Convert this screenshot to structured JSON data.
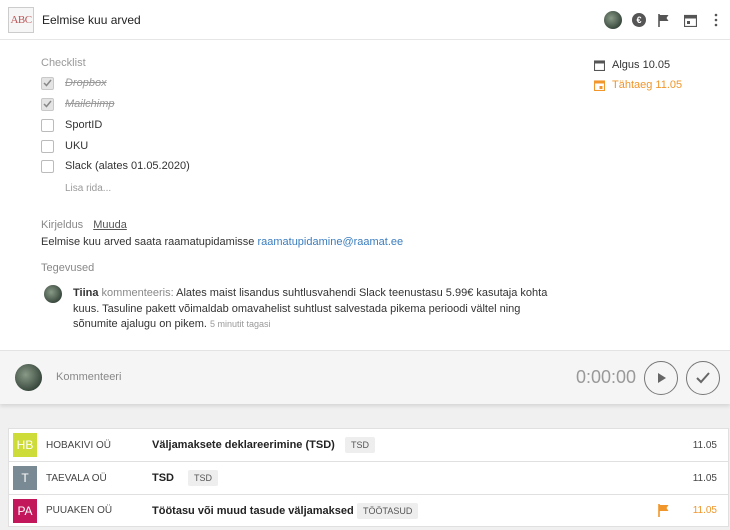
{
  "header": {
    "logo_text": "ABC",
    "title": "Eelmise kuu arved",
    "icons": [
      "avatar",
      "euro-icon",
      "flag-icon",
      "calendar-icon",
      "more-vertical-icon"
    ],
    "euro_symbol": "€"
  },
  "checklist": {
    "label": "Checklist",
    "items": [
      {
        "text": "Dropbox",
        "done": true
      },
      {
        "text": "Mailchimp",
        "done": true
      },
      {
        "text": "SportID",
        "done": false
      },
      {
        "text": "UKU",
        "done": false
      },
      {
        "text": "Slack (alates 01.05.2020)",
        "done": false
      }
    ],
    "add_placeholder": "Lisa rida..."
  },
  "dates": {
    "start": "Algus 10.05",
    "due": "Tähtaeg 11.05",
    "due_color": "#f0962a"
  },
  "description": {
    "label": "Kirjeldus",
    "edit_link": "Muuda",
    "text": "Eelmise kuu arved saata raamatupidamisse",
    "email": "raamatupidamine@raamat.ee"
  },
  "activities": {
    "label": "Tegevused",
    "items": [
      {
        "author": "Tiina",
        "verb": "kommenteeris:",
        "text": "Alates maist lisandus suhtlusvahendi Slack teenustasu 5.99€ kasutaja kohta kuus. Tasuline pakett võimaldab omavahelist suhtlust salvestada pikema perioodi vältel ning sõnumite ajalugu on pikem.",
        "ago": "5 minutit tagasi"
      }
    ]
  },
  "footer": {
    "comment_placeholder": "Kommenteeri",
    "timer": "0:00:00"
  },
  "tasks": [
    {
      "badge": "HB",
      "badge_color": "#cddc39",
      "company": "HOBAKIVI OÜ",
      "name": "Väljamaksete deklareerimine (TSD)",
      "tag": "TSD",
      "date": "11.05",
      "flag": false
    },
    {
      "badge": "T",
      "badge_color": "#7a8a94",
      "company": "TAEVALA OÜ",
      "name": "TSD",
      "tag": "TSD",
      "date": "11.05",
      "flag": false
    },
    {
      "badge": "PA",
      "badge_color": "#c2185b",
      "company": "PUUAKEN OÜ",
      "name": "Töötasu või muud tasude väljamaksed",
      "tag": "TÖÖTASUD",
      "date": "11.05",
      "flag": true
    }
  ]
}
